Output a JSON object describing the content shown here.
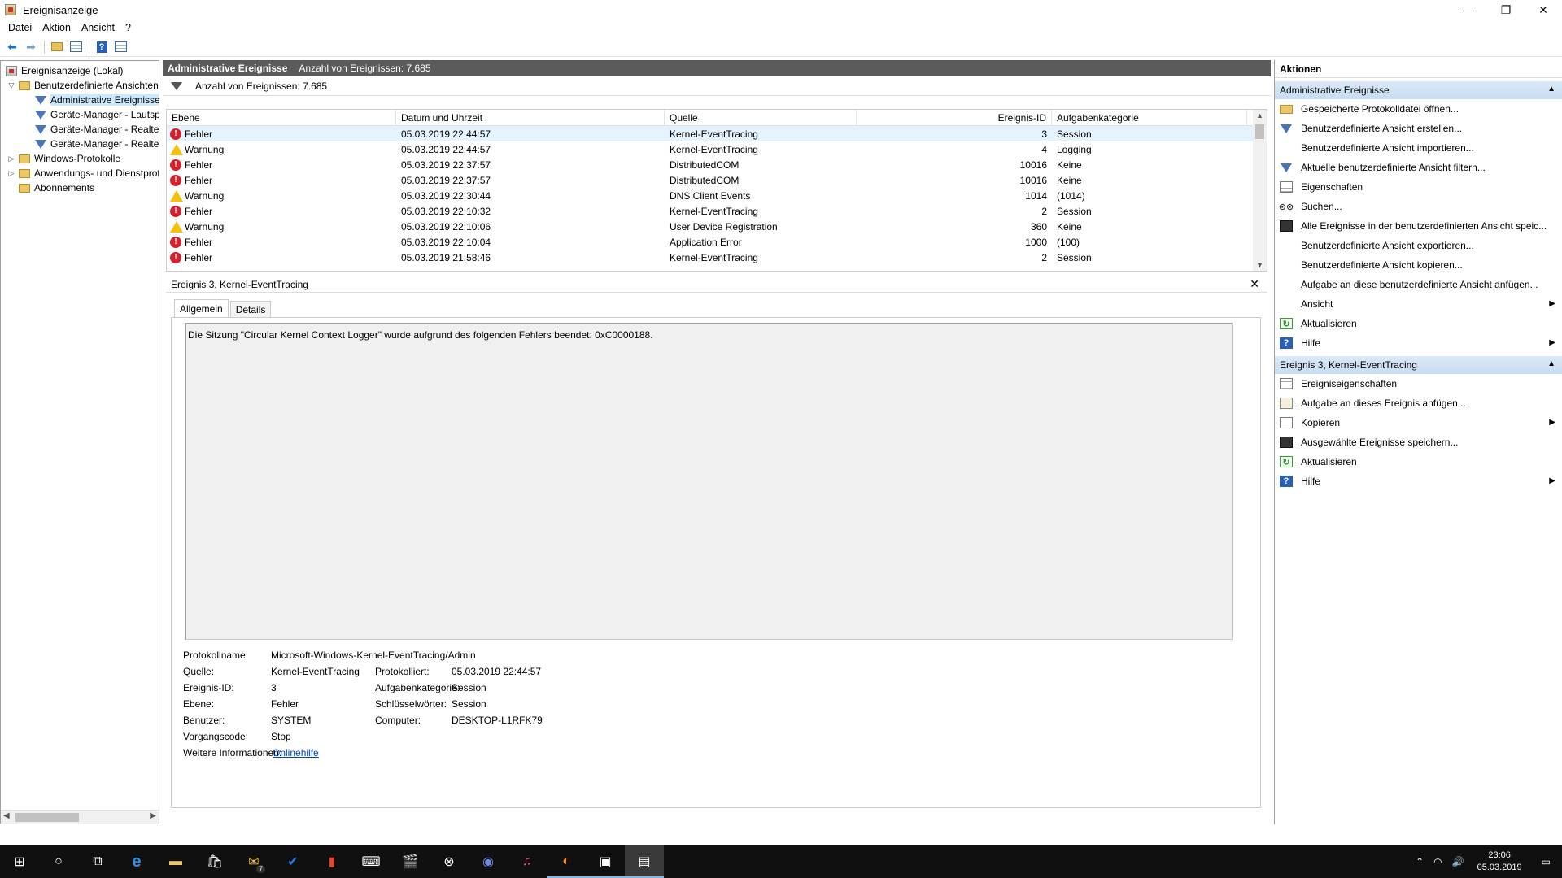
{
  "window": {
    "title": "Ereignisanzeige",
    "controls": [
      "—",
      "❐",
      "✕"
    ]
  },
  "menu": [
    "Datei",
    "Aktion",
    "Ansicht",
    "?"
  ],
  "tree": [
    {
      "label": "Ereignisanzeige (Lokal)",
      "icon": "event-viewer-icon"
    },
    {
      "label": "Benutzerdefinierte Ansichten",
      "icon": "folder-icon",
      "toggle": "▽"
    },
    {
      "label": "Administrative Ereignisse",
      "icon": "filter-icon",
      "selected": true
    },
    {
      "label": "Geräte-Manager - Lautsprecher",
      "icon": "filter-icon"
    },
    {
      "label": "Geräte-Manager - Realtek",
      "icon": "filter-icon"
    },
    {
      "label": "Geräte-Manager - Realtek",
      "icon": "filter-icon"
    },
    {
      "label": "Windows-Protokolle",
      "icon": "folder-icon",
      "toggle": "▷"
    },
    {
      "label": "Anwendungs- und Dienstprotokolle",
      "icon": "folder-icon",
      "toggle": "▷"
    },
    {
      "label": "Abonnements",
      "icon": "folder-icon"
    }
  ],
  "center": {
    "header_title": "Administrative Ereignisse",
    "header_count": "Anzahl von Ereignissen: 7.685",
    "filter_count": "Anzahl von Ereignissen: 7.685",
    "columns": [
      "Ebene",
      "Datum und Uhrzeit",
      "Quelle",
      "Ereignis-ID",
      "Aufgabenkategorie"
    ],
    "rows": [
      {
        "level": "Fehler",
        "type": "error",
        "date": "05.03.2019 22:44:57",
        "source": "Kernel-EventTracing",
        "id": "3",
        "category": "Session"
      },
      {
        "level": "Warnung",
        "type": "warning",
        "date": "05.03.2019 22:44:57",
        "source": "Kernel-EventTracing",
        "id": "4",
        "category": "Logging"
      },
      {
        "level": "Fehler",
        "type": "error",
        "date": "05.03.2019 22:37:57",
        "source": "DistributedCOM",
        "id": "10016",
        "category": "Keine"
      },
      {
        "level": "Fehler",
        "type": "error",
        "date": "05.03.2019 22:37:57",
        "source": "DistributedCOM",
        "id": "10016",
        "category": "Keine"
      },
      {
        "level": "Warnung",
        "type": "warning",
        "date": "05.03.2019 22:30:44",
        "source": "DNS Client Events",
        "id": "1014",
        "category": "(1014)"
      },
      {
        "level": "Fehler",
        "type": "error",
        "date": "05.03.2019 22:10:32",
        "source": "Kernel-EventTracing",
        "id": "2",
        "category": "Session"
      },
      {
        "level": "Warnung",
        "type": "warning",
        "date": "05.03.2019 22:10:06",
        "source": "User Device Registration",
        "id": "360",
        "category": "Keine"
      },
      {
        "level": "Fehler",
        "type": "error",
        "date": "05.03.2019 22:10:04",
        "source": "Application Error",
        "id": "1000",
        "category": "(100)"
      },
      {
        "level": "Fehler",
        "type": "error",
        "date": "05.03.2019 21:58:46",
        "source": "Kernel-EventTracing",
        "id": "2",
        "category": "Session"
      }
    ],
    "detail_title": "Ereignis 3, Kernel-EventTracing",
    "tabs": [
      "Allgemein",
      "Details"
    ],
    "message": "Die Sitzung \"Circular Kernel Context Logger\" wurde aufgrund des folgenden Fehlers beendet: 0xC0000188.",
    "props": {
      "log_name_label": "Protokollname:",
      "log_name": "Microsoft-Windows-Kernel-EventTracing/Admin",
      "source_label": "Quelle:",
      "source": "Kernel-EventTracing",
      "logged_label": "Protokolliert:",
      "logged": "05.03.2019 22:44:57",
      "id_label": "Ereignis-ID:",
      "id": "3",
      "task_label": "Aufgabenkategorie:",
      "task": "Session",
      "level_label": "Ebene:",
      "level": "Fehler",
      "keywords_label": "Schlüsselwörter:",
      "keywords": "Session",
      "user_label": "Benutzer:",
      "user": "SYSTEM",
      "computer_label": "Computer:",
      "computer": "DESKTOP-L1RFK79",
      "opcode_label": "Vorgangscode:",
      "opcode": "Stop",
      "more_label": "Weitere Informationen:",
      "more_link": "Onlinehilfe"
    }
  },
  "actions": {
    "title": "Aktionen",
    "section1": "Administrative Ereignisse",
    "items1": [
      {
        "label": "Gespeicherte Protokolldatei öffnen...",
        "icon": "folder-open-icon"
      },
      {
        "label": "Benutzerdefinierte Ansicht erstellen...",
        "icon": "filter-icon"
      },
      {
        "label": "Benutzerdefinierte Ansicht importieren...",
        "icon": "blank"
      },
      {
        "label": "Aktuelle benutzerdefinierte Ansicht filtern...",
        "icon": "filter-icon"
      },
      {
        "label": "Eigenschaften",
        "icon": "properties-icon"
      },
      {
        "label": "Suchen...",
        "icon": "binoculars-icon"
      },
      {
        "label": "Alle Ereignisse in der benutzerdefinierten Ansicht speic...",
        "icon": "save-icon"
      },
      {
        "label": "Benutzerdefinierte Ansicht exportieren...",
        "icon": "blank"
      },
      {
        "label": "Benutzerdefinierte Ansicht kopieren...",
        "icon": "blank"
      },
      {
        "label": "Aufgabe an diese benutzerdefinierte Ansicht anfügen...",
        "icon": "blank"
      },
      {
        "label": "Ansicht",
        "icon": "blank",
        "submenu": true
      },
      {
        "label": "Aktualisieren",
        "icon": "refresh-icon"
      },
      {
        "label": "Hilfe",
        "icon": "help-icon",
        "submenu": true
      }
    ],
    "section2": "Ereignis 3, Kernel-EventTracing",
    "items2": [
      {
        "label": "Ereigniseigenschaften",
        "icon": "properties-icon"
      },
      {
        "label": "Aufgabe an dieses Ereignis anfügen...",
        "icon": "task-icon"
      },
      {
        "label": "Kopieren",
        "icon": "copy-icon",
        "submenu": true
      },
      {
        "label": "Ausgewählte Ereignisse speichern...",
        "icon": "save-icon"
      },
      {
        "label": "Aktualisieren",
        "icon": "refresh-icon"
      },
      {
        "label": "Hilfe",
        "icon": "help-icon",
        "submenu": true
      }
    ]
  },
  "taskbar": {
    "badge_mail": "7",
    "time": "23:06",
    "date": "05.03.2019"
  }
}
